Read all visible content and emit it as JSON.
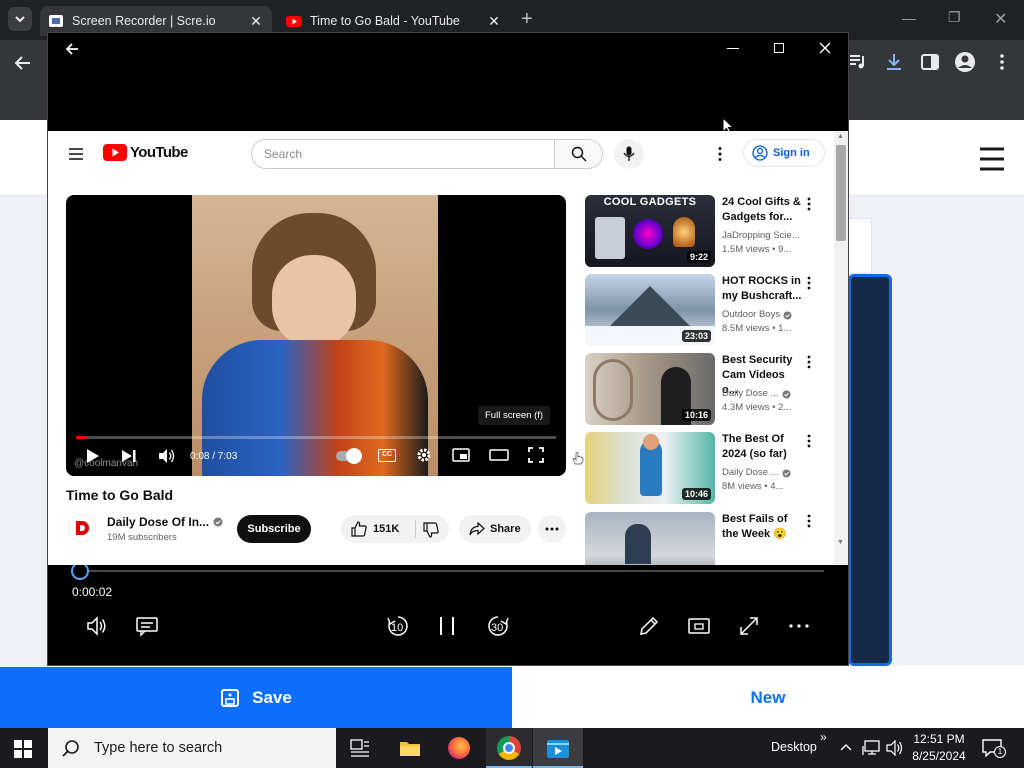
{
  "browser": {
    "tabs": [
      {
        "title": "Screen Recorder | Scre.io",
        "active": true
      },
      {
        "title": "Time to Go Bald - YouTube",
        "active": false
      }
    ],
    "new_tab_symbol": "+"
  },
  "page": {
    "save_label": "Save",
    "new_label": "New"
  },
  "youtube": {
    "logo_text": "YouTube",
    "search_placeholder": "Search",
    "sign_in": "Sign in",
    "tooltip": "Full screen (f)",
    "watermark": "@coolmanvan",
    "time": "0:08 / 7:03",
    "video_title": "Time to Go Bald",
    "channel": "Daily Dose Of In...",
    "subscribers": "19M subscribers",
    "subscribe": "Subscribe",
    "likes": "151K",
    "share": "Share",
    "progress_fraction": 0.02,
    "recommendations": [
      {
        "title_line1": "24 Cool Gifts &",
        "title_line2": "Gadgets for...",
        "channel": "JaDropping Scie...",
        "meta": "1.5M views • 9...",
        "duration": "9:22",
        "thumb_caption": "COOL GADGETS",
        "verified": false
      },
      {
        "title_line1": "HOT ROCKS in",
        "title_line2": "my Bushcraft...",
        "channel": "Outdoor Boys",
        "meta": "8.5M views • 1...",
        "duration": "23:03",
        "thumb_caption": "",
        "verified": true
      },
      {
        "title_line1": "Best Security",
        "title_line2": "Cam Videos o...",
        "channel": "Daily Dose ...",
        "meta": "4.3M views • 2...",
        "duration": "10:16",
        "thumb_caption": "",
        "verified": true
      },
      {
        "title_line1": "The Best Of",
        "title_line2": "2024 (so far)",
        "channel": "Daily Dose ...",
        "meta": "8M views • 4...",
        "duration": "10:46",
        "thumb_caption": "",
        "verified": true
      },
      {
        "title_line1": "Best Fails of",
        "title_line2": "the Week 😮",
        "channel": "",
        "meta": "",
        "duration": "",
        "thumb_caption": "",
        "verified": false
      }
    ]
  },
  "player": {
    "elapsed": "0:00:02",
    "rewind_label": "10",
    "forward_label": "30",
    "progress_fraction": 0.01
  },
  "taskbar": {
    "search_placeholder": "Type here to search",
    "desktop_label": "Desktop",
    "time": "12:51 PM",
    "date": "8/25/2024",
    "notification_count": "1"
  },
  "colors": {
    "accent_blue": "#0d6efd",
    "youtube_red": "#ff0000",
    "dark_navy": "#142a47"
  }
}
